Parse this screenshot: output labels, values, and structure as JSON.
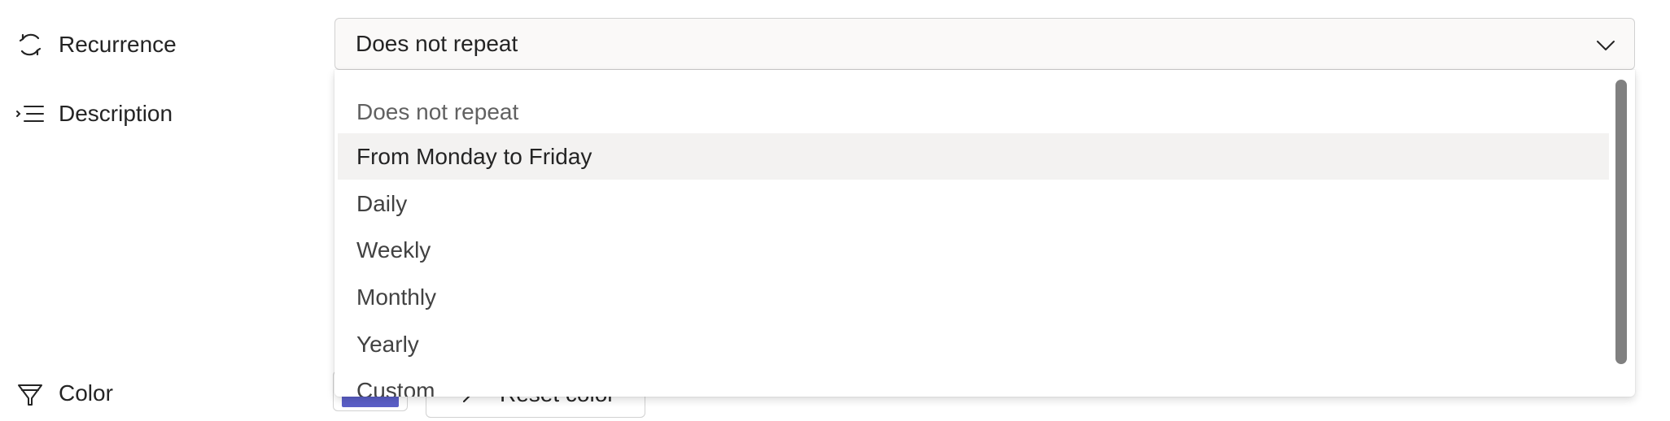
{
  "recurrence": {
    "label": "Recurrence",
    "icon": "recurrence-icon",
    "selected_value": "Does not repeat",
    "options": [
      "Does not repeat",
      "From Monday to Friday",
      "Daily",
      "Weekly",
      "Monthly",
      "Yearly",
      "Custom"
    ],
    "hovered_option": "From Monday to Friday"
  },
  "description": {
    "label": "Description",
    "icon": "description-icon"
  },
  "color": {
    "label": "Color",
    "icon": "paint-bucket-icon",
    "swatch_color": "#5b5fc7",
    "reset_label": "Reset color"
  }
}
